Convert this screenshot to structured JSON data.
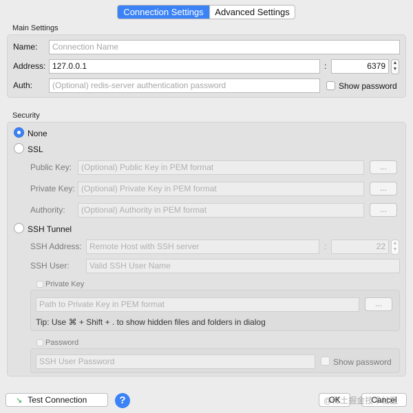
{
  "tabs": {
    "connection": "Connection Settings",
    "advanced": "Advanced Settings"
  },
  "main": {
    "section": "Main Settings",
    "name_label": "Name:",
    "name_placeholder": "Connection Name",
    "address_label": "Address:",
    "address_value": "127.0.0.1",
    "colon": ":",
    "port_value": "6379",
    "auth_label": "Auth:",
    "auth_placeholder": "(Optional) redis-server authentication password",
    "show_password": "Show password"
  },
  "security": {
    "section": "Security",
    "none_label": "None",
    "ssl_label": "SSL",
    "public_key_label": "Public Key:",
    "public_key_placeholder": "(Optional) Public Key in PEM format",
    "private_key_label": "Private Key:",
    "private_key_placeholder": "(Optional) Private Key in PEM format",
    "authority_label": "Authority:",
    "authority_placeholder": "(Optional) Authority in PEM format",
    "browse": "...",
    "ssh_label": "SSH Tunnel",
    "ssh_address_label": "SSH Address:",
    "ssh_address_placeholder": "Remote Host with SSH server",
    "ssh_port_value": "22",
    "ssh_user_label": "SSH User:",
    "ssh_user_placeholder": "Valid SSH User Name",
    "private_key_check": "Private Key",
    "private_key_path_placeholder": "Path to Private Key in PEM format",
    "tip": "Tip: Use ⌘ + Shift + . to show hidden files and folders in dialog",
    "password_check": "Password",
    "ssh_password_placeholder": "SSH User Password",
    "show_password": "Show password"
  },
  "footer": {
    "test_connection": "Test Connection",
    "help": "?",
    "ok": "OK",
    "cancel": "Cancel",
    "watermark": "@稀土掘金技术社区"
  },
  "colors": {
    "accent": "#3b82f6",
    "background": "#ececec"
  },
  "icons": {
    "test": "plug-icon",
    "help": "question-icon",
    "stepper": "up-down-arrows-icon"
  }
}
